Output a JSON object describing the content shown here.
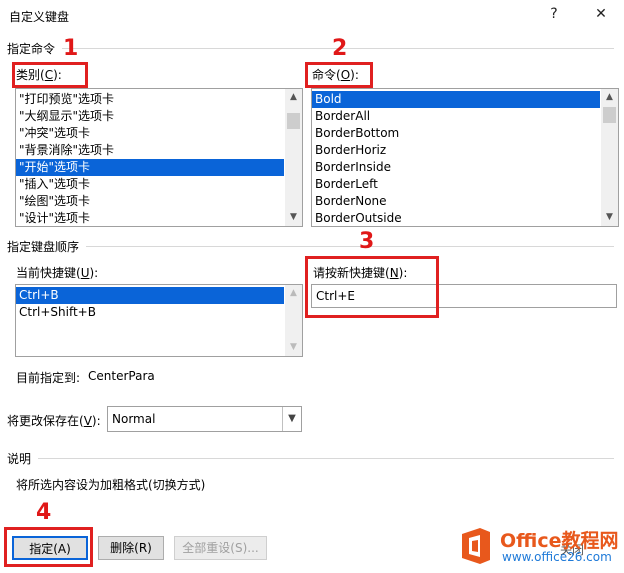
{
  "window": {
    "title": "自定义键盘",
    "help_glyph": "?",
    "close_glyph": "✕"
  },
  "specify_command": {
    "section_label": "指定命令",
    "categories_label": "类别(",
    "categories_hotkey": "C",
    "categories_suffix": "):",
    "categories": [
      "\"打印预览\"选项卡",
      "\"大纲显示\"选项卡",
      "\"冲突\"选项卡",
      "\"背景消除\"选项卡",
      "\"开始\"选项卡",
      "\"插入\"选项卡",
      "\"绘图\"选项卡",
      "\"设计\"选项卡"
    ],
    "categories_selected_index": 4,
    "commands_label": "命令(",
    "commands_hotkey": "O",
    "commands_suffix": "):",
    "commands": [
      "Bold",
      "BorderAll",
      "BorderBottom",
      "BorderHoriz",
      "BorderInside",
      "BorderLeft",
      "BorderNone",
      "BorderOutside"
    ],
    "commands_selected_index": 0
  },
  "keyboard_sequence": {
    "section_label": "指定键盘顺序",
    "current_keys_label": "当前快捷键(",
    "current_keys_hotkey": "U",
    "current_keys_suffix": "):",
    "current_keys": [
      "Ctrl+B",
      "Ctrl+Shift+B"
    ],
    "current_keys_selected_index": 0,
    "new_key_label": "请按新快捷键(",
    "new_key_hotkey": "N",
    "new_key_suffix": "):",
    "new_key_value": "Ctrl+E",
    "assigned_label": "目前指定到:",
    "assigned_value": "CenterPara"
  },
  "save_in": {
    "label": "将更改保存在(",
    "hotkey": "V",
    "suffix": "):",
    "value": "Normal"
  },
  "description": {
    "section_label": "说明",
    "text": "将所选内容设为加粗格式(切换方式)"
  },
  "buttons": {
    "assign": "指定(A)",
    "remove": "删除(R)",
    "reset_all": "全部重设(S)...",
    "close_partial": "关闭"
  },
  "annotations": {
    "n1": "1",
    "n2": "2",
    "n3": "3",
    "n4": "4"
  },
  "watermark": {
    "brand": "Office教程网",
    "url": "www.office26.com"
  },
  "colors": {
    "selection": "#0a64d8",
    "annotation": "#e02020",
    "brand_orange": "#e8581c",
    "brand_blue": "#1f7ad8"
  }
}
